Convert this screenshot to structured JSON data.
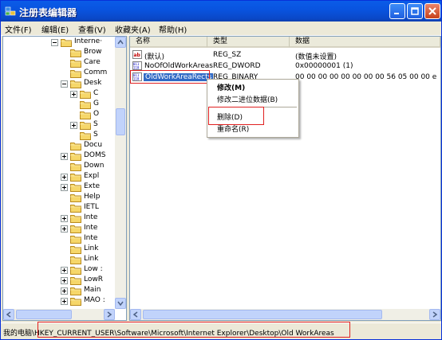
{
  "window": {
    "title": "注册表编辑器"
  },
  "menu": [
    "文件(F)",
    "编辑(E)",
    "查看(V)",
    "收藏夹(A)",
    "帮助(H)"
  ],
  "tree": {
    "items": [
      {
        "label": "Interne·",
        "exp": "minus"
      },
      {
        "label": "Brow",
        "exp": ""
      },
      {
        "label": "Care",
        "exp": ""
      },
      {
        "label": "Comm",
        "exp": ""
      },
      {
        "label": "Desk",
        "exp": "minus"
      },
      {
        "label": "C",
        "exp": "plus"
      },
      {
        "label": "G",
        "exp": ""
      },
      {
        "label": "O",
        "exp": ""
      },
      {
        "label": "S",
        "exp": "plus"
      },
      {
        "label": "S",
        "exp": ""
      },
      {
        "label": "Docu",
        "exp": ""
      },
      {
        "label": "DOMS",
        "exp": "plus"
      },
      {
        "label": "Down",
        "exp": ""
      },
      {
        "label": "Expl",
        "exp": "plus"
      },
      {
        "label": "Exte",
        "exp": "plus"
      },
      {
        "label": "Help",
        "exp": ""
      },
      {
        "label": "IETL",
        "exp": ""
      },
      {
        "label": "Inte",
        "exp": "plus"
      },
      {
        "label": "Inte",
        "exp": "plus"
      },
      {
        "label": "Inte",
        "exp": ""
      },
      {
        "label": "Link",
        "exp": ""
      },
      {
        "label": "Link",
        "exp": ""
      },
      {
        "label": "Low :",
        "exp": "plus"
      },
      {
        "label": "LowR",
        "exp": "plus"
      },
      {
        "label": "Main",
        "exp": "plus"
      },
      {
        "label": "MAO :",
        "exp": "plus"
      }
    ]
  },
  "list": {
    "headers": [
      "名称",
      "类型",
      "数据"
    ],
    "rows": [
      {
        "name": "(默认)",
        "type": "REG_SZ",
        "data": "(数值未设置)",
        "icon": "ab"
      },
      {
        "name": "NoOfOldWorkAreas",
        "type": "REG_DWORD",
        "data": "0x00000001 (1)",
        "icon": "bin"
      },
      {
        "name": "OldWorkAreaRects",
        "type": "REG_BINARY",
        "data": "00 00 00 00 00 00 00 00 56 05 00 00 e",
        "icon": "bin"
      }
    ]
  },
  "context_menu": {
    "modify": "修改(M)",
    "modify_binary": "修改二进位数据(B)",
    "delete": "删除(D)",
    "rename": "重命名(R)"
  },
  "status": "我的电脑\\HKEY_CURRENT_USER\\Software\\Microsoft\\Internet Explorer\\Desktop\\Old WorkAreas",
  "colors": {
    "selection": "#316ac5",
    "highlight_box": "#e02020",
    "title_bar": "#0a5ce8"
  }
}
